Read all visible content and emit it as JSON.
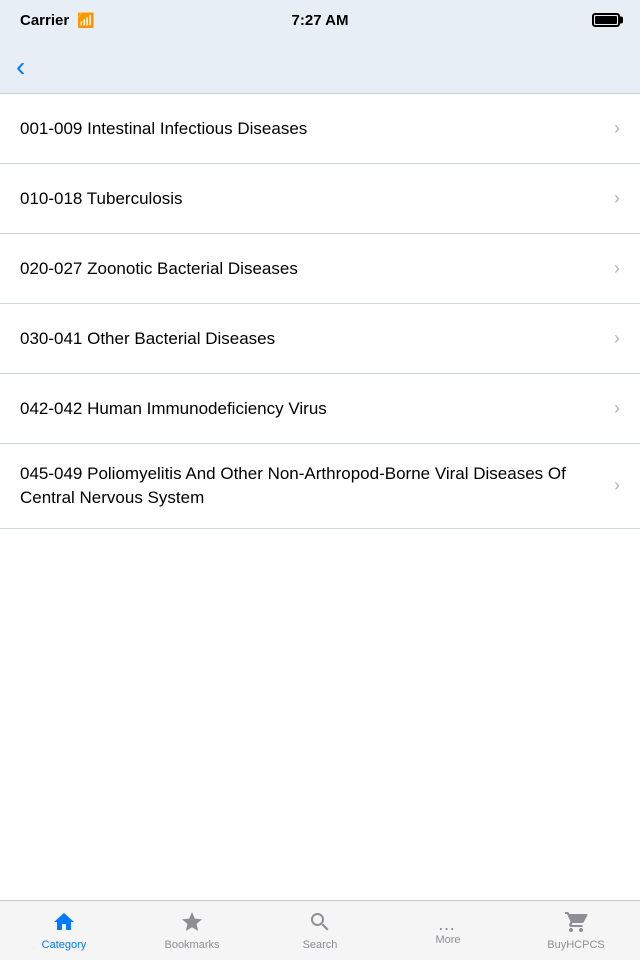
{
  "statusBar": {
    "carrier": "Carrier",
    "time": "7:27 AM"
  },
  "navBar": {
    "backLabel": "<"
  },
  "listItems": [
    {
      "id": 1,
      "label": "001-009 Intestinal Infectious Diseases"
    },
    {
      "id": 2,
      "label": "010-018 Tuberculosis"
    },
    {
      "id": 3,
      "label": "020-027 Zoonotic Bacterial Diseases"
    },
    {
      "id": 4,
      "label": "030-041 Other Bacterial Diseases"
    },
    {
      "id": 5,
      "label": "042-042 Human Immunodeficiency Virus"
    },
    {
      "id": 6,
      "label": "045-049 Poliomyelitis And Other Non-Arthropod-Borne Viral Diseases Of Central Nervous System"
    }
  ],
  "tabBar": {
    "items": [
      {
        "id": "category",
        "label": "Category",
        "active": true
      },
      {
        "id": "bookmarks",
        "label": "Bookmarks",
        "active": false
      },
      {
        "id": "search",
        "label": "Search",
        "active": false
      },
      {
        "id": "more",
        "label": "More",
        "active": false
      },
      {
        "id": "buyhcpcs",
        "label": "BuyHCPCS",
        "active": false
      }
    ]
  }
}
